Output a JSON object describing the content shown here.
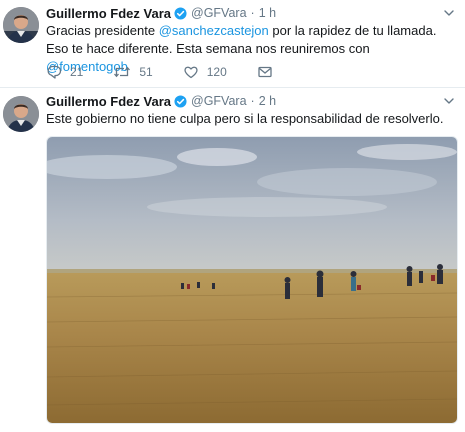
{
  "tweets": [
    {
      "author": {
        "name": "Guillermo Fdez Vara",
        "handle": "@GFVara",
        "verified": true,
        "avatar_icon": "avatar-photo"
      },
      "separator": "·",
      "time": "1 h",
      "text": {
        "p1": "Gracias presidente ",
        "m1": "@sanchezcastejon",
        "p2": " por la rapidez de tu llamada. Eso te hace diferente. Esta semana nos reuniremos con ",
        "m2": "@fomentogob"
      },
      "actions": {
        "reply": "21",
        "retweet": "51",
        "like": "120"
      }
    },
    {
      "author": {
        "name": "Guillermo Fdez Vara",
        "handle": "@GFVara",
        "verified": true,
        "avatar_icon": "avatar-photo"
      },
      "separator": "·",
      "time": "2 h",
      "text": {
        "p1": "Este gobierno no tiene culpa pero si la responsabilidad de resolverlo."
      },
      "media": {
        "type": "photo",
        "description_icon": "wheat-field-photo"
      }
    }
  ],
  "colors": {
    "accent": "#1b95e0",
    "secondary_text": "#657786",
    "primary_text": "#14171a"
  }
}
